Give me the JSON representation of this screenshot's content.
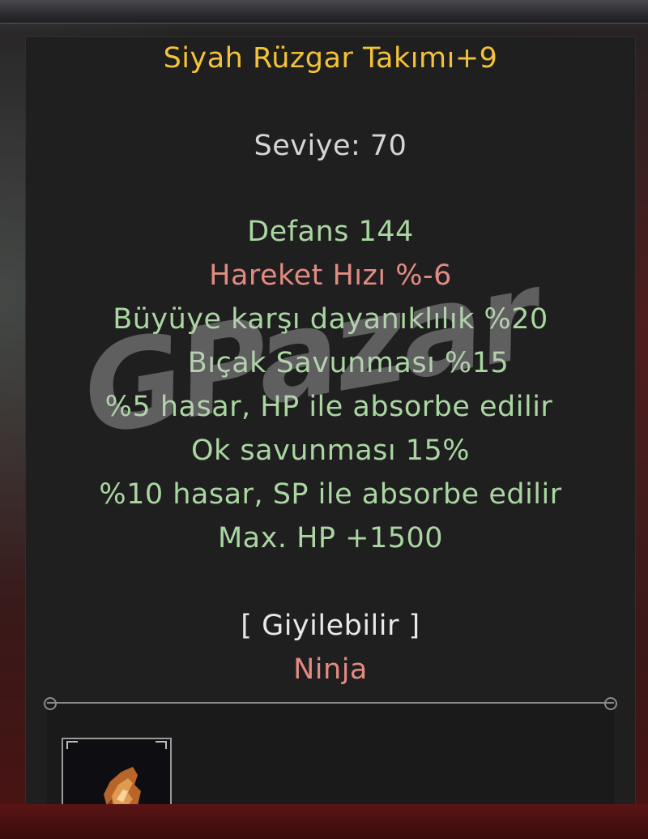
{
  "tooltip": {
    "title": "Siyah Rüzgar Takımı+9",
    "level": "Seviye: 70",
    "stats": [
      {
        "text": "Defans 144",
        "tone": "green"
      },
      {
        "text": "Hareket Hızı %-6",
        "tone": "red"
      },
      {
        "text": "Büyüye karşı dayanıklılık %20",
        "tone": "green"
      },
      {
        "text": "Bıçak Savunması %15",
        "tone": "green"
      },
      {
        "text": "%5 hasar, HP ile absorbe edilir",
        "tone": "green"
      },
      {
        "text": "Ok savunması 15%",
        "tone": "green"
      },
      {
        "text": "%10 hasar, SP ile absorbe edilir",
        "tone": "green"
      },
      {
        "text": "Max. HP +1500",
        "tone": "green"
      }
    ],
    "wearable": "[ Giyilebilir ]",
    "class": "Ninja"
  },
  "watermark": "GPazar",
  "equipment_slot": {
    "icon": "armor-item-icon"
  },
  "colors": {
    "title": "#f2c338",
    "positive": "#a9d6a1",
    "negative": "#e38a82",
    "neutral": "#d6d6d6"
  }
}
